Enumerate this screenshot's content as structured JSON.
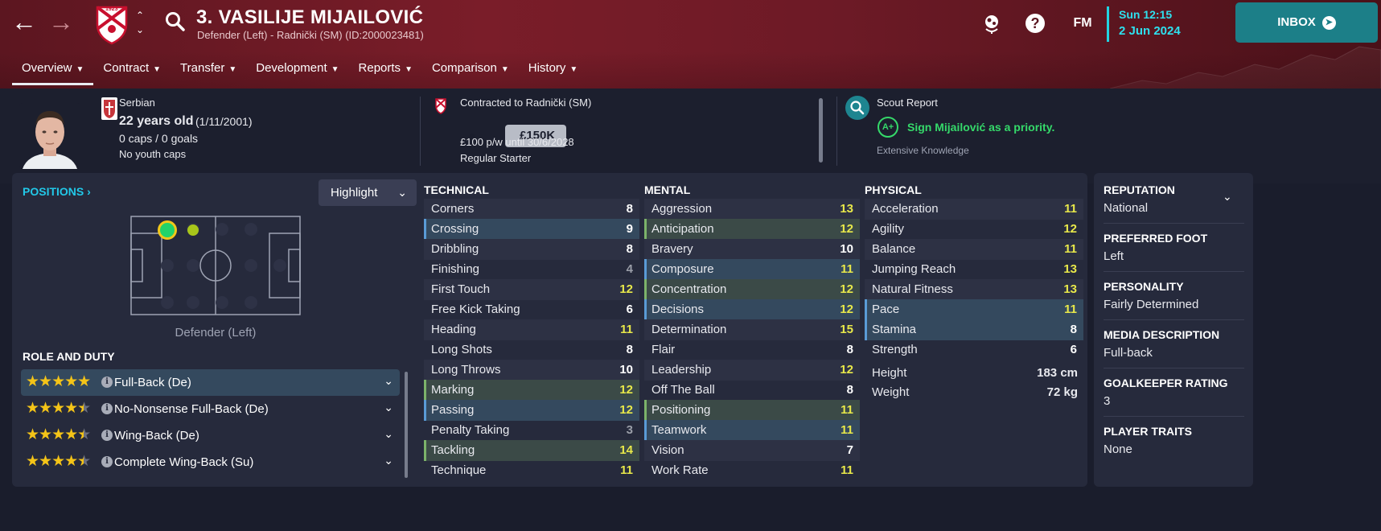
{
  "header": {
    "title": "3. VASILIJE MIJAILOVIĆ",
    "subtitle": "Defender (Left) - Radnički (SM) (ID:2000023481)",
    "back_icon": "back-arrow-icon",
    "forward_icon": "forward-arrow-icon",
    "club_badge_year": "1923",
    "fm_label": "FM",
    "help_label": "?",
    "date_time": "Sun 12:15",
    "date": "2 Jun 2024",
    "inbox_label": "INBOX",
    "accent_color": "#22d3e0",
    "brand_color": "#7a1d29"
  },
  "tabs": [
    {
      "label": "Overview",
      "active": true
    },
    {
      "label": "Contract"
    },
    {
      "label": "Transfer"
    },
    {
      "label": "Development"
    },
    {
      "label": "Reports"
    },
    {
      "label": "Comparison"
    },
    {
      "label": "History"
    }
  ],
  "info": {
    "nationality": "Serbian",
    "age": "22 years old",
    "dob": "(1/11/2001)",
    "caps": "0 caps / 0 goals",
    "youth_caps": "No youth caps",
    "contract_to": "Contracted to Radnički (SM)",
    "value": "£150K",
    "wage": "£100 p/w until 30/6/2028",
    "squad_status": "Regular Starter",
    "scout_title": "Scout Report",
    "scout_grade": "A+",
    "scout_text": "Sign Mijailović as a priority.",
    "scout_knowledge": "Extensive Knowledge"
  },
  "positions": {
    "heading": "POSITIONS",
    "highlight_label": "Highlight",
    "pitch_label": "Defender (Left)",
    "natural_color": "#22d36a",
    "accomplished_color": "#a8c61a"
  },
  "roles": {
    "heading": "ROLE AND DUTY",
    "items": [
      {
        "stars": "★★★★★",
        "name": "Full-Back (De)",
        "rating": 5
      },
      {
        "stars": "★★★★★",
        "name": "No-Nonsense Full-Back (De)",
        "rating": 4.5
      },
      {
        "stars": "★★★★★",
        "name": "Wing-Back (De)",
        "rating": 4.5
      },
      {
        "stars": "★★★★★",
        "name": "Complete Wing-Back (Su)",
        "rating": 4.5
      }
    ]
  },
  "technical": {
    "heading": "TECHNICAL",
    "rows": [
      {
        "name": "Corners",
        "value": "8",
        "c": "w",
        "hl": ""
      },
      {
        "name": "Crossing",
        "value": "9",
        "c": "w",
        "hl": "b"
      },
      {
        "name": "Dribbling",
        "value": "8",
        "c": "w",
        "hl": ""
      },
      {
        "name": "Finishing",
        "value": "4",
        "c": "g",
        "hl": ""
      },
      {
        "name": "First Touch",
        "value": "12",
        "c": "y",
        "hl": ""
      },
      {
        "name": "Free Kick Taking",
        "value": "6",
        "c": "w",
        "hl": ""
      },
      {
        "name": "Heading",
        "value": "11",
        "c": "y",
        "hl": ""
      },
      {
        "name": "Long Shots",
        "value": "8",
        "c": "w",
        "hl": ""
      },
      {
        "name": "Long Throws",
        "value": "10",
        "c": "w",
        "hl": ""
      },
      {
        "name": "Marking",
        "value": "12",
        "c": "y",
        "hl": "g"
      },
      {
        "name": "Passing",
        "value": "12",
        "c": "y",
        "hl": "b"
      },
      {
        "name": "Penalty Taking",
        "value": "3",
        "c": "g",
        "hl": ""
      },
      {
        "name": "Tackling",
        "value": "14",
        "c": "y",
        "hl": "g"
      },
      {
        "name": "Technique",
        "value": "11",
        "c": "y",
        "hl": ""
      }
    ]
  },
  "mental": {
    "heading": "MENTAL",
    "rows": [
      {
        "name": "Aggression",
        "value": "13",
        "c": "y",
        "hl": ""
      },
      {
        "name": "Anticipation",
        "value": "12",
        "c": "y",
        "hl": "g"
      },
      {
        "name": "Bravery",
        "value": "10",
        "c": "w",
        "hl": ""
      },
      {
        "name": "Composure",
        "value": "11",
        "c": "y",
        "hl": "b"
      },
      {
        "name": "Concentration",
        "value": "12",
        "c": "y",
        "hl": "g"
      },
      {
        "name": "Decisions",
        "value": "12",
        "c": "y",
        "hl": "b"
      },
      {
        "name": "Determination",
        "value": "15",
        "c": "y",
        "hl": ""
      },
      {
        "name": "Flair",
        "value": "8",
        "c": "w",
        "hl": ""
      },
      {
        "name": "Leadership",
        "value": "12",
        "c": "y",
        "hl": ""
      },
      {
        "name": "Off The Ball",
        "value": "8",
        "c": "w",
        "hl": ""
      },
      {
        "name": "Positioning",
        "value": "11",
        "c": "y",
        "hl": "g"
      },
      {
        "name": "Teamwork",
        "value": "11",
        "c": "y",
        "hl": "b"
      },
      {
        "name": "Vision",
        "value": "7",
        "c": "w",
        "hl": ""
      },
      {
        "name": "Work Rate",
        "value": "11",
        "c": "y",
        "hl": ""
      }
    ]
  },
  "physical": {
    "heading": "PHYSICAL",
    "rows": [
      {
        "name": "Acceleration",
        "value": "11",
        "c": "y",
        "hl": ""
      },
      {
        "name": "Agility",
        "value": "12",
        "c": "y",
        "hl": ""
      },
      {
        "name": "Balance",
        "value": "11",
        "c": "y",
        "hl": ""
      },
      {
        "name": "Jumping Reach",
        "value": "13",
        "c": "y",
        "hl": ""
      },
      {
        "name": "Natural Fitness",
        "value": "13",
        "c": "y",
        "hl": ""
      },
      {
        "name": "Pace",
        "value": "11",
        "c": "y",
        "hl": "b"
      },
      {
        "name": "Stamina",
        "value": "8",
        "c": "w",
        "hl": "b"
      },
      {
        "name": "Strength",
        "value": "6",
        "c": "w",
        "hl": ""
      }
    ],
    "height_label": "Height",
    "height_value": "183 cm",
    "weight_label": "Weight",
    "weight_value": "72 kg"
  },
  "sidepanel": [
    {
      "heading": "REPUTATION",
      "value": "National"
    },
    {
      "heading": "PREFERRED FOOT",
      "value": "Left"
    },
    {
      "heading": "PERSONALITY",
      "value": "Fairly Determined"
    },
    {
      "heading": "MEDIA DESCRIPTION",
      "value": "Full-back"
    },
    {
      "heading": "GOALKEEPER RATING",
      "value": "3"
    },
    {
      "heading": "PLAYER TRAITS",
      "value": "None"
    }
  ]
}
